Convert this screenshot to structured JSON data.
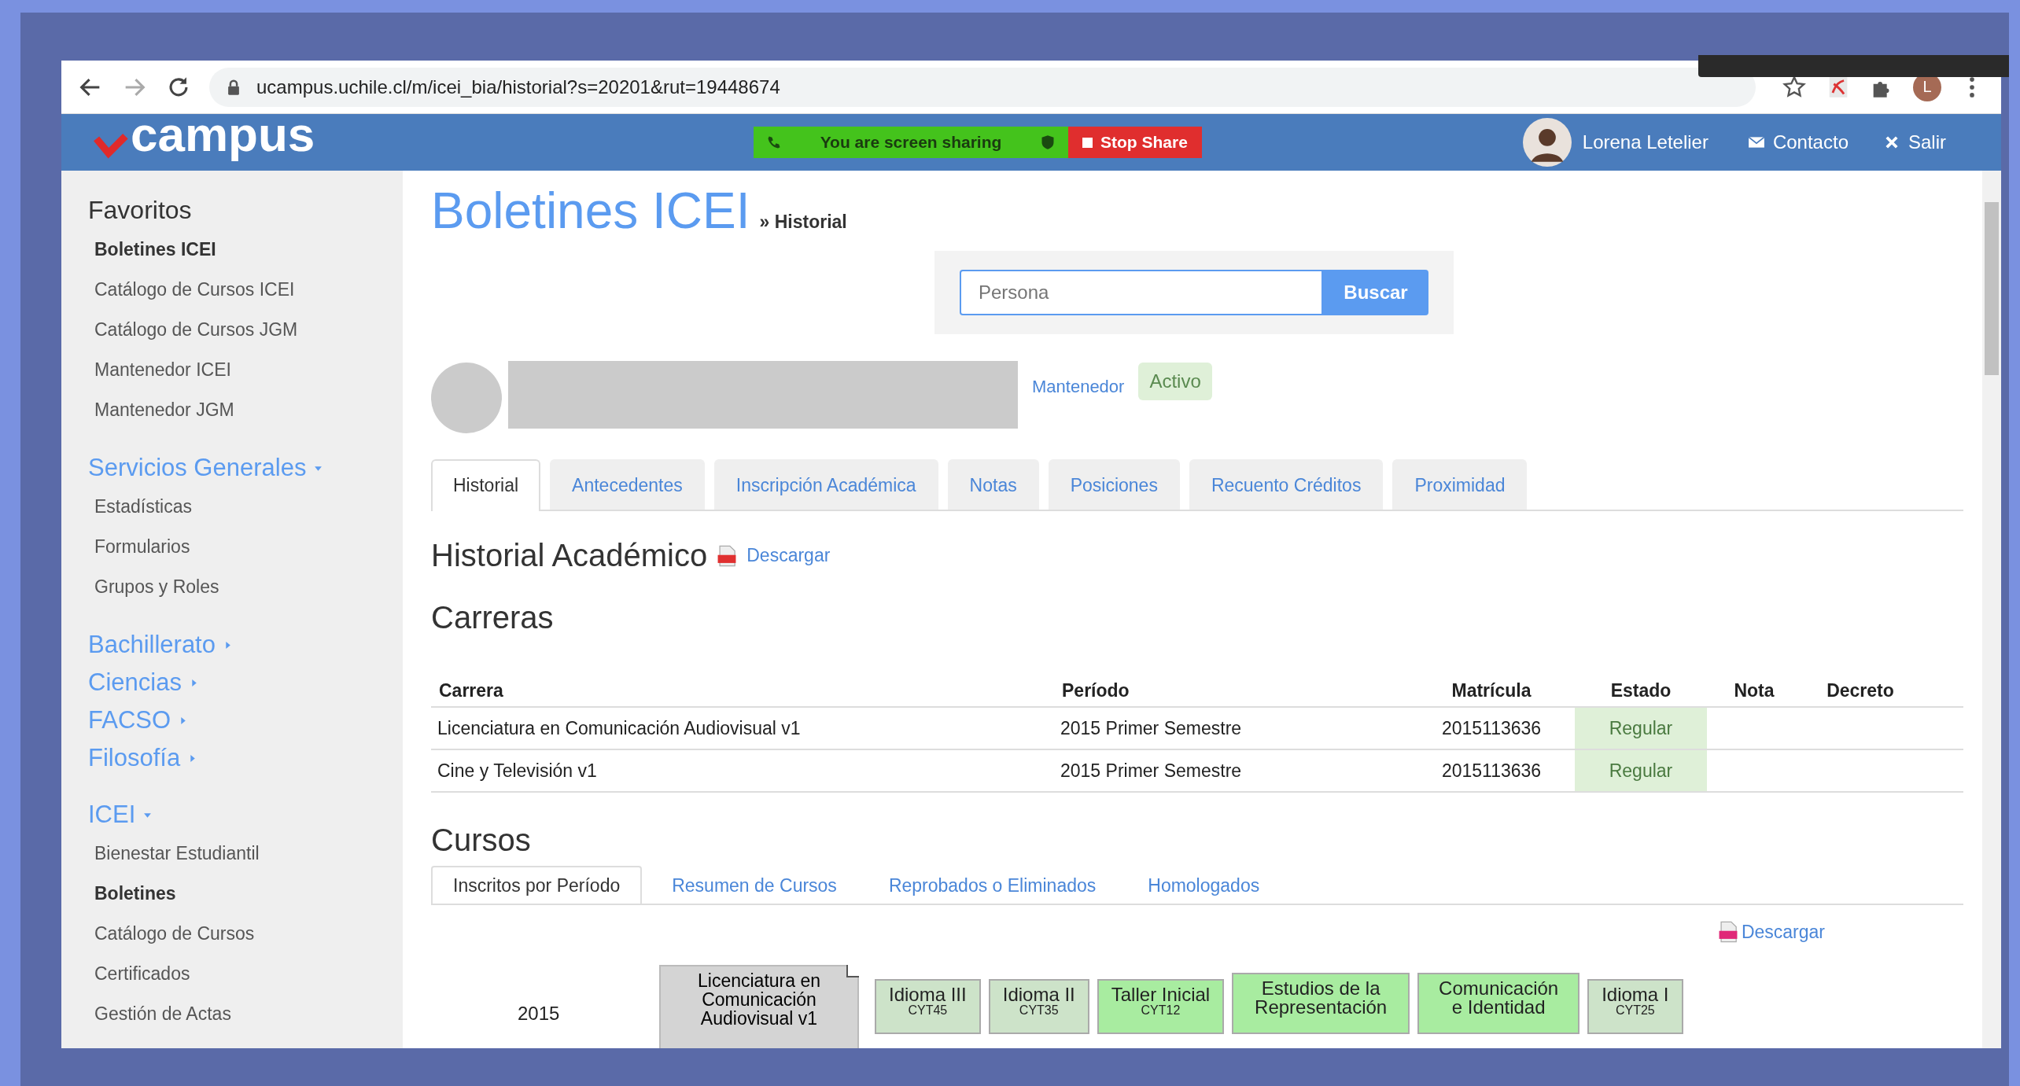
{
  "browser": {
    "url": "ucampus.uchile.cl/m/icei_bia/historial?s=20201&rut=19448674",
    "profile_initial": "L"
  },
  "header": {
    "logo_text": "campus",
    "share_text": "You are screen sharing",
    "stop_label": "Stop Share",
    "user_name": "Lorena Letelier",
    "links": [
      {
        "label": "Contacto",
        "kind": "mail"
      },
      {
        "label": "Salir",
        "kind": "exit"
      }
    ]
  },
  "sidebar": {
    "favorites_title": "Favoritos",
    "favorites": [
      {
        "label": "Boletines ICEI",
        "selected": true
      },
      {
        "label": "Catálogo de Cursos ICEI",
        "selected": false
      },
      {
        "label": "Catálogo de Cursos JGM",
        "selected": false
      },
      {
        "label": "Mantenedor ICEI",
        "selected": false
      },
      {
        "label": "Mantenedor JGM",
        "selected": false
      }
    ],
    "sections": [
      {
        "title": "Servicios Generales",
        "expanded": true,
        "items": [
          {
            "label": "Estadísticas",
            "selected": false
          },
          {
            "label": "Formularios",
            "selected": false
          },
          {
            "label": "Grupos y Roles",
            "selected": false
          }
        ]
      },
      {
        "title": "Bachillerato",
        "expanded": false
      },
      {
        "title": "Ciencias",
        "expanded": false
      },
      {
        "title": "FACSO",
        "expanded": false
      },
      {
        "title": "Filosofía",
        "expanded": false
      },
      {
        "title": "ICEI",
        "expanded": true,
        "items": [
          {
            "label": "Bienestar Estudiantil",
            "selected": false
          },
          {
            "label": "Boletines",
            "selected": true
          },
          {
            "label": "Catálogo de Cursos",
            "selected": false
          },
          {
            "label": "Certificados",
            "selected": false
          },
          {
            "label": "Gestión de Actas",
            "selected": false
          }
        ]
      }
    ]
  },
  "page": {
    "title": "Boletines ICEI",
    "breadcrumb": "» Historial",
    "search": {
      "placeholder": "Persona",
      "button": "Buscar"
    },
    "profile": {
      "link": "Mantenedor",
      "status": "Activo"
    },
    "tabs": [
      {
        "label": "Historial",
        "selected": true
      },
      {
        "label": "Antecedentes",
        "selected": false
      },
      {
        "label": "Inscripción Académica",
        "selected": false
      },
      {
        "label": "Notas",
        "selected": false
      },
      {
        "label": "Posiciones",
        "selected": false
      },
      {
        "label": "Recuento Créditos",
        "selected": false
      },
      {
        "label": "Proximidad",
        "selected": false
      }
    ],
    "history_heading": "Historial Académico",
    "history_download": "Descargar",
    "careers_heading": "Carreras",
    "careers_table": {
      "columns": [
        "Carrera",
        "Período",
        "Matrícula",
        "Estado",
        "Nota",
        "Decreto"
      ],
      "rows": [
        [
          "Licenciatura en Comunicación Audiovisual v1",
          "2015 Primer Semestre",
          "2015113636",
          "Regular",
          "",
          ""
        ],
        [
          "Cine y Televisión v1",
          "2015 Primer Semestre",
          "2015113636",
          "Regular",
          "",
          ""
        ]
      ]
    },
    "courses_heading": "Cursos",
    "course_tabs": [
      {
        "label": "Inscritos por Período",
        "selected": true
      },
      {
        "label": "Resumen de Cursos",
        "selected": false
      },
      {
        "label": "Reprobados o Eliminados",
        "selected": false
      },
      {
        "label": "Homologados",
        "selected": false
      }
    ],
    "courses_download": "Descargar",
    "period": "2015",
    "career_box": "Licenciatura en Comunicación Audiovisual v1",
    "courses": [
      {
        "name": "Idioma III",
        "code": "CYT45",
        "color": "#cde3c9"
      },
      {
        "name": "Idioma II",
        "code": "CYT35",
        "color": "#cde3c9"
      },
      {
        "name": "Taller Inicial",
        "code": "CYT12",
        "color": "#a8eca0"
      },
      {
        "name": "Estudios de la Representación",
        "color": "#a8eca0"
      },
      {
        "name": "Comunicación e Identidad",
        "color": "#a8eca0"
      },
      {
        "name": "Idioma I",
        "code": "CYT25",
        "color": "#cde3c9"
      }
    ]
  }
}
